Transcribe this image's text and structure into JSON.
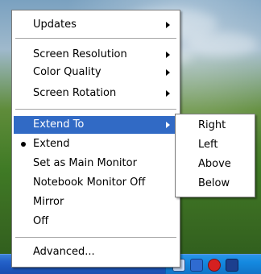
{
  "menu": {
    "items": [
      {
        "label": "Updates",
        "has_submenu": true
      },
      {
        "label": "Screen Resolution",
        "has_submenu": true
      },
      {
        "label": "Color Quality",
        "has_submenu": true
      },
      {
        "label": "Screen Rotation",
        "has_submenu": true
      },
      {
        "label": "Extend To",
        "has_submenu": true,
        "selected": true
      },
      {
        "label": "Extend",
        "checked": true
      },
      {
        "label": "Set as Main Monitor"
      },
      {
        "label": "Notebook Monitor Off"
      },
      {
        "label": "Mirror"
      },
      {
        "label": "Off"
      },
      {
        "label": "Advanced..."
      }
    ]
  },
  "submenu": {
    "items": [
      "Right",
      "Left",
      "Above",
      "Below"
    ]
  },
  "colors": {
    "highlight": "#316ac5",
    "menu_bg": "#ffffff",
    "taskbar": "#2462c9",
    "tray": "#1489df"
  },
  "tray_icons": [
    "monitor-icon",
    "network-icon",
    "security-shield-icon",
    "display-adapter-icon"
  ]
}
